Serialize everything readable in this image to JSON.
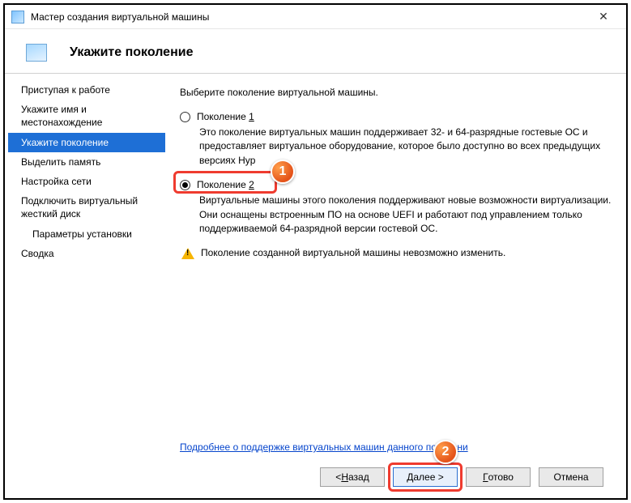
{
  "window": {
    "title": "Мастер создания виртуальной машины"
  },
  "page": {
    "title": "Укажите поколение"
  },
  "sidebar": {
    "items": [
      {
        "label": "Приступая к работе"
      },
      {
        "label": "Укажите имя и местонахождение"
      },
      {
        "label": "Укажите поколение"
      },
      {
        "label": "Выделить память"
      },
      {
        "label": "Настройка сети"
      },
      {
        "label": "Подключить виртуальный жесткий диск"
      },
      {
        "label": "Параметры установки"
      },
      {
        "label": "Сводка"
      }
    ]
  },
  "content": {
    "intro": "Выберите поколение виртуальной машины.",
    "gen1_label_pre": "Поколение ",
    "gen1_label_ul": "1",
    "gen1_desc": "Это поколение виртуальных машин поддерживает 32- и 64-разрядные гостевые ОС и предоставляет виртуальное оборудование, которое было доступно во всех предыдущих версиях Hyp",
    "gen2_label_pre": "Поколение ",
    "gen2_label_ul": "2",
    "gen2_desc": "Виртуальные машины этого поколения поддерживают новые возможности виртуализации. Они оснащены встроенным ПО на основе UEFI и работают под управлением только поддерживаемой 64-разрядной версии гостевой ОС.",
    "warning": "Поколение созданной виртуальной машины невозможно изменить.",
    "more_link": "Подробнее о поддержке виртуальных машин данного поколени"
  },
  "buttons": {
    "back_ul": "Н",
    "back_rest": "азад",
    "back_pre": "< ",
    "next_ul": "Д",
    "next_rest": "алее >",
    "finish_ul": "Г",
    "finish_rest": "отово",
    "cancel": "Отмена"
  },
  "annotations": {
    "badge1": "1",
    "badge2": "2"
  }
}
